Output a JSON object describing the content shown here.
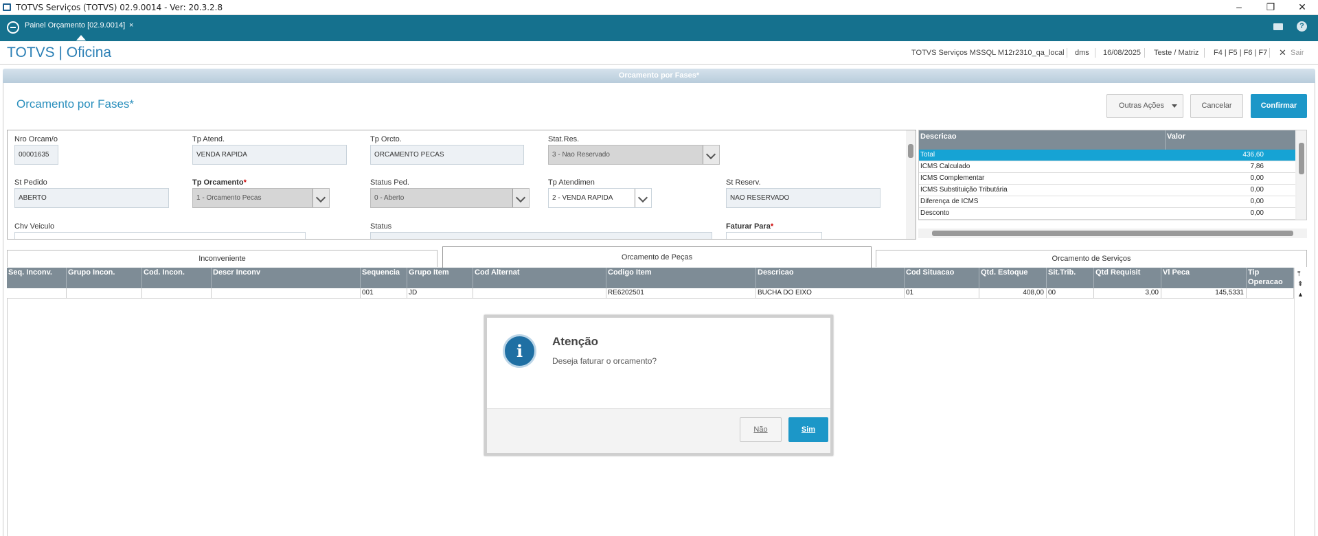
{
  "window": {
    "title": "TOTVS Serviços (TOTVS) 02.9.0014 - Ver: 20.3.2.8"
  },
  "tabbar": {
    "tab_label": "Painel Orçamento [02.9.0014]",
    "tab_close": "×"
  },
  "header": {
    "brand": "TOTVS | Oficina",
    "environment": "TOTVS Serviços MSSQL M12r2310_qa_local",
    "user": "dms",
    "date": "16/08/2025",
    "branch": "Teste / Matriz",
    "shortcuts": "F4 | F5 | F6 | F7",
    "exit": "Sair"
  },
  "banner": {
    "title": "Orcamento por Fases*"
  },
  "page": {
    "title": "Orcamento por Fases*",
    "other_actions": "Outras Ações",
    "cancel": "Cancelar",
    "confirm": "Confirmar"
  },
  "form": {
    "nro_orcamento": {
      "label": "Nro Orcam/o",
      "value": "00001635"
    },
    "tp_atend": {
      "label": "Tp Atend.",
      "value": "VENDA RAPIDA"
    },
    "tp_orcto": {
      "label": "Tp Orcto.",
      "value": "ORCAMENTO PECAS"
    },
    "stat_res": {
      "label": "Stat.Res.",
      "value": "3 - Nao Reservado"
    },
    "st_pedido": {
      "label": "St Pedido",
      "value": "ABERTO"
    },
    "tp_orcamento": {
      "label": "Tp Orcamento",
      "value": "1 - Orcamento Pecas"
    },
    "status_ped": {
      "label": "Status Ped.",
      "value": "0 - Aberto"
    },
    "tp_atendimen": {
      "label": "Tp Atendimen",
      "value": "2 - VENDA RAPIDA"
    },
    "st_reserv": {
      "label": "St Reserv.",
      "value": "NAO RESERVADO"
    },
    "chv_veiculo": {
      "label": "Chv Veiculo"
    },
    "status": {
      "label": "Status"
    },
    "faturar_para": {
      "label": "Faturar Para"
    }
  },
  "totals": {
    "col_desc": "Descricao",
    "col_valor": "Valor",
    "rows": [
      {
        "desc": "Total",
        "valor": "436,60"
      },
      {
        "desc": "ICMS Calculado",
        "valor": "7,86"
      },
      {
        "desc": "ICMS Complementar",
        "valor": "0,00"
      },
      {
        "desc": "ICMS Substituição Tributária",
        "valor": "0,00"
      },
      {
        "desc": "Diferença de ICMS",
        "valor": "0,00"
      },
      {
        "desc": "Desconto",
        "valor": "0,00"
      }
    ]
  },
  "tabs": {
    "inconveniente": "Inconveniente",
    "pecas": "Orcamento de Peças",
    "servicos": "Orcamento de Serviços"
  },
  "grid": {
    "headers": [
      "Seq. Inconv.",
      "Grupo Incon.",
      "Cod. Incon.",
      "Descr Inconv",
      "Sequencia",
      "Grupo Item",
      "Cod Alternat",
      "Codigo Item",
      "Descricao",
      "Cod Situacao",
      "Qtd. Estoque",
      "Sit.Trib.",
      "Qtd Requisit",
      "Vl Peca",
      "Tip Operacao"
    ],
    "row": [
      "",
      "",
      "",
      "",
      "001",
      "JD",
      "",
      "RE6202501",
      "BUCHA DO EIXO",
      "01",
      "408,00",
      "00",
      "3,00",
      "145,5331",
      ""
    ]
  },
  "dialog": {
    "title": "Atenção",
    "message": "Deseja faturar o orcamento?",
    "no": "Não",
    "yes": "Sim"
  }
}
